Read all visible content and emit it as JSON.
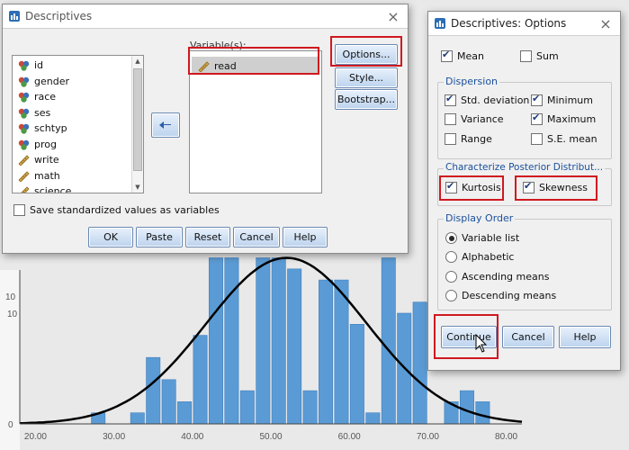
{
  "chart_data": {
    "type": "bar",
    "x_tick_labels": [
      "20.00",
      "30.00",
      "40.00",
      "50.00",
      "60.00",
      "70.00",
      "80.00"
    ],
    "y_tick_labels": [
      "0",
      "10"
    ],
    "bars": [
      {
        "x": 28,
        "y": 1
      },
      {
        "x": 33,
        "y": 1
      },
      {
        "x": 35,
        "y": 6
      },
      {
        "x": 37,
        "y": 4
      },
      {
        "x": 39,
        "y": 2
      },
      {
        "x": 41,
        "y": 8
      },
      {
        "x": 43,
        "y": 15
      },
      {
        "x": 45,
        "y": 15
      },
      {
        "x": 47,
        "y": 3
      },
      {
        "x": 49,
        "y": 15
      },
      {
        "x": 51,
        "y": 15
      },
      {
        "x": 53,
        "y": 14
      },
      {
        "x": 55,
        "y": 3
      },
      {
        "x": 57,
        "y": 13
      },
      {
        "x": 59,
        "y": 13
      },
      {
        "x": 61,
        "y": 9
      },
      {
        "x": 63,
        "y": 1
      },
      {
        "x": 65,
        "y": 15
      },
      {
        "x": 67,
        "y": 10
      },
      {
        "x": 69,
        "y": 11
      },
      {
        "x": 73,
        "y": 2
      },
      {
        "x": 75,
        "y": 3
      },
      {
        "x": 77,
        "y": 2
      }
    ],
    "normal_curve": {
      "mean": 52,
      "sd": 10.2,
      "peak": 15
    },
    "xlim": [
      18,
      82
    ]
  },
  "descriptives": {
    "title": "Descriptives",
    "variables": [
      "id",
      "gender",
      "race",
      "ses",
      "schtyp",
      "prog",
      "write",
      "math",
      "science"
    ],
    "variable_types": [
      "nominal",
      "nominal",
      "nominal",
      "nominal",
      "nominal",
      "nominal",
      "scale",
      "scale",
      "scale"
    ],
    "selected_label": "Variable(s):",
    "selected_variables": [
      "read"
    ],
    "options_button": "Options...",
    "style_button": "Style...",
    "bootstrap_button": "Bootstrap...",
    "save_standardized": "Save standardized values as variables",
    "buttons": {
      "ok": "OK",
      "paste": "Paste",
      "reset": "Reset",
      "cancel": "Cancel",
      "help": "Help"
    }
  },
  "options": {
    "title": "Descriptives: Options",
    "mean": "Mean",
    "sum": "Sum",
    "dispersion_label": "Dispersion",
    "std_deviation": "Std. deviation",
    "minimum": "Minimum",
    "variance": "Variance",
    "maximum": "Maximum",
    "range": "Range",
    "se_mean": "S.E. mean",
    "posterior_label": "Characterize Posterior Distribut...",
    "kurtosis": "Kurtosis",
    "skewness": "Skewness",
    "display_order_label": "Display Order",
    "order_variable_list": "Variable list",
    "order_alphabetic": "Alphabetic",
    "order_ascending": "Ascending means",
    "order_descending": "Descending means",
    "continue_button": "Continue",
    "cancel_button": "Cancel",
    "help_button": "Help",
    "checked": {
      "mean": true,
      "sum": false,
      "std_deviation": true,
      "minimum": true,
      "variance": false,
      "maximum": true,
      "range": false,
      "se_mean": false,
      "kurtosis": true,
      "skewness": true
    },
    "selected_order": "variable_list"
  },
  "colors": {
    "bar": "#5b9bd5",
    "highlight": "#d01820",
    "curve": "#000000",
    "accent": "#1a4f9c"
  }
}
